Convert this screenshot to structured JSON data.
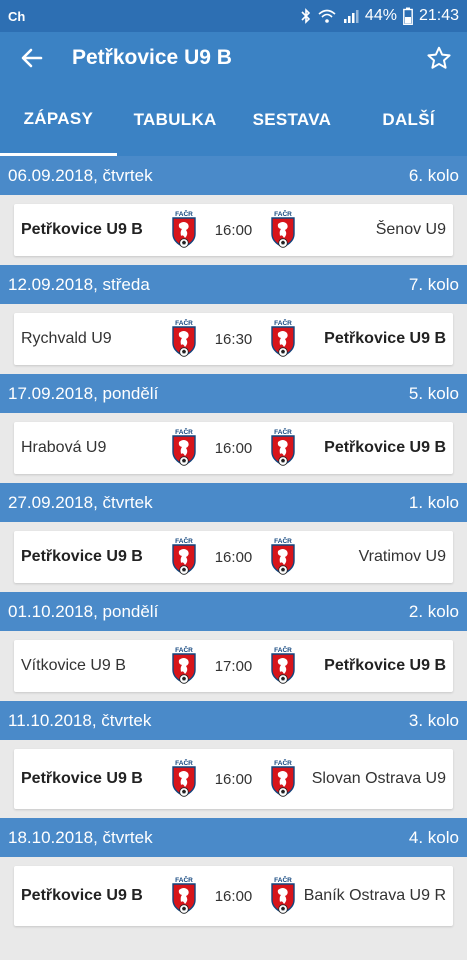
{
  "status_bar": {
    "carrier": "Ch",
    "battery": "44%",
    "time": "21:43"
  },
  "app_bar": {
    "title": "Petřkovice U9 B"
  },
  "tabs": [
    {
      "label": "ZÁPASY"
    },
    {
      "label": "TABULKA"
    },
    {
      "label": "SESTAVA"
    },
    {
      "label": "DALŠÍ"
    }
  ],
  "matches": [
    {
      "date": "06.09.2018, čtvrtek",
      "round": "6. kolo",
      "home": "Petřkovice U9 B",
      "time": "16:00",
      "away": "Šenov U9"
    },
    {
      "date": "12.09.2018, středa",
      "round": "7. kolo",
      "home": "Rychvald U9",
      "time": "16:30",
      "away": "Petřkovice U9 B"
    },
    {
      "date": "17.09.2018, pondělí",
      "round": "5. kolo",
      "home": "Hrabová U9",
      "time": "16:00",
      "away": "Petřkovice U9 B"
    },
    {
      "date": "27.09.2018, čtvrtek",
      "round": "1. kolo",
      "home": "Petřkovice U9 B",
      "time": "16:00",
      "away": "Vratimov U9"
    },
    {
      "date": "01.10.2018, pondělí",
      "round": "2. kolo",
      "home": "Vítkovice U9 B",
      "time": "17:00",
      "away": "Petřkovice U9 B"
    },
    {
      "date": "11.10.2018, čtvrtek",
      "round": "3. kolo",
      "home": "Petřkovice U9 B",
      "time": "16:00",
      "away": "Slovan Ostrava U9"
    },
    {
      "date": "18.10.2018, čtvrtek",
      "round": "4. kolo",
      "home": "Petřkovice U9 B",
      "time": "16:00",
      "away": "Baník Ostrava U9 R"
    }
  ],
  "crest": {
    "label": "FAČR"
  },
  "colors": {
    "primary": "#3b82c4",
    "header": "#4a8ac9",
    "crest_red": "#d7141a",
    "crest_blue": "#11457e"
  }
}
